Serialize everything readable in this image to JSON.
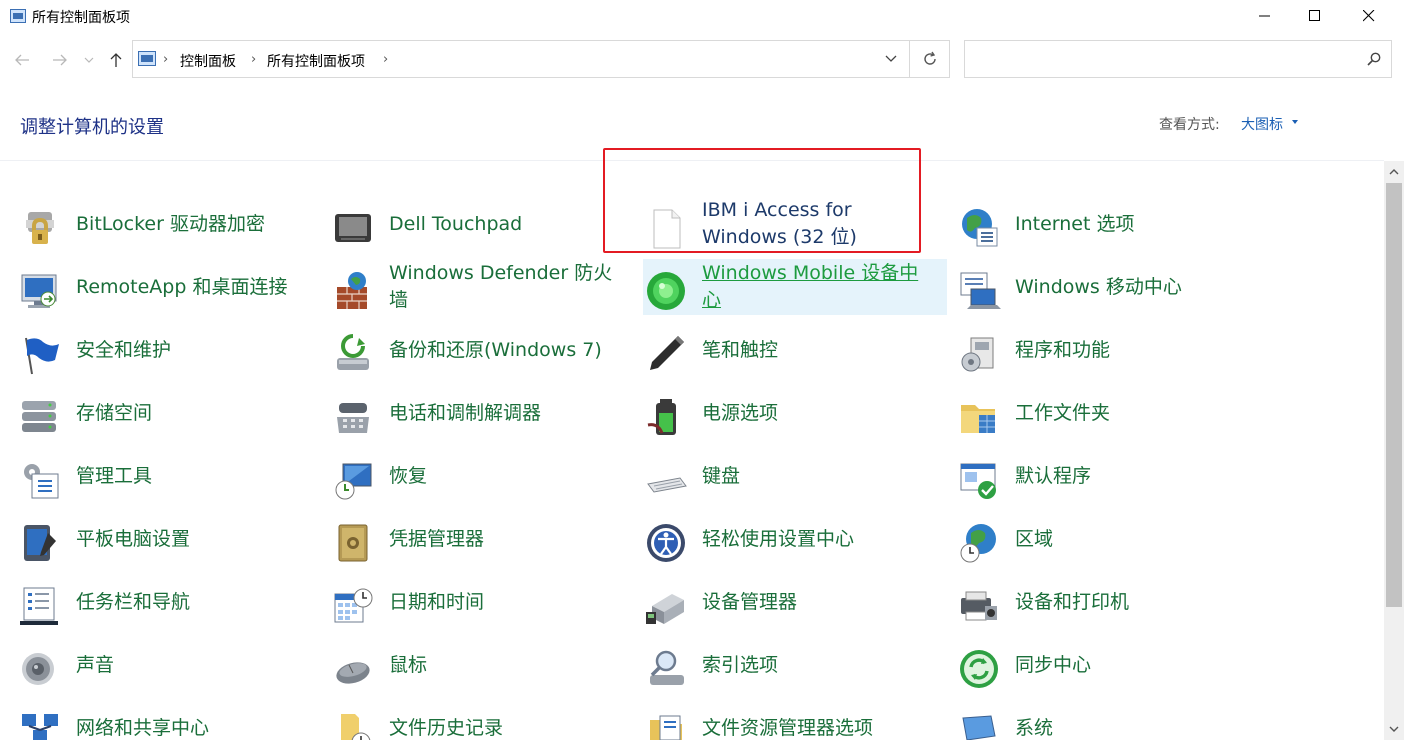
{
  "window": {
    "title": "所有控制面板项"
  },
  "breadcrumb": {
    "items": [
      "控制面板",
      "所有控制面板项"
    ]
  },
  "search": {
    "placeholder": "",
    "value": ""
  },
  "header": {
    "title": "调整计算机的设置",
    "view_by_label": "查看方式:",
    "view_by_value": "大图标"
  },
  "items": [
    {
      "label": "BitLocker 驱动器加密",
      "icon": "bitlocker-icon"
    },
    {
      "label": "Dell Touchpad",
      "icon": "touchpad-icon"
    },
    {
      "label": "IBM i Access for Windows (32 位)",
      "icon": "blank-document-icon"
    },
    {
      "label": "Internet 选项",
      "icon": "internet-options-icon"
    },
    {
      "label": "RemoteApp 和桌面连接",
      "icon": "remoteapp-icon"
    },
    {
      "label": "Windows Defender 防火墙",
      "icon": "firewall-icon"
    },
    {
      "label": "Windows Mobile 设备中心",
      "icon": "mobile-device-center-icon"
    },
    {
      "label": "Windows 移动中心",
      "icon": "mobility-center-icon"
    },
    {
      "label": "安全和维护",
      "icon": "security-flag-icon"
    },
    {
      "label": "备份和还原(Windows 7)",
      "icon": "backup-restore-icon"
    },
    {
      "label": "笔和触控",
      "icon": "pen-icon"
    },
    {
      "label": "程序和功能",
      "icon": "programs-features-icon"
    },
    {
      "label": "存储空间",
      "icon": "storage-spaces-icon"
    },
    {
      "label": "电话和调制解调器",
      "icon": "phone-modem-icon"
    },
    {
      "label": "电源选项",
      "icon": "power-options-icon"
    },
    {
      "label": "工作文件夹",
      "icon": "work-folders-icon"
    },
    {
      "label": "管理工具",
      "icon": "admin-tools-icon"
    },
    {
      "label": "恢复",
      "icon": "recovery-icon"
    },
    {
      "label": "键盘",
      "icon": "keyboard-icon"
    },
    {
      "label": "默认程序",
      "icon": "default-programs-icon"
    },
    {
      "label": "平板电脑设置",
      "icon": "tablet-settings-icon"
    },
    {
      "label": "凭据管理器",
      "icon": "credential-manager-icon"
    },
    {
      "label": "轻松使用设置中心",
      "icon": "ease-of-access-icon"
    },
    {
      "label": "区域",
      "icon": "region-icon"
    },
    {
      "label": "任务栏和导航",
      "icon": "taskbar-icon"
    },
    {
      "label": "日期和时间",
      "icon": "date-time-icon"
    },
    {
      "label": "设备管理器",
      "icon": "device-manager-icon"
    },
    {
      "label": "设备和打印机",
      "icon": "devices-printers-icon"
    },
    {
      "label": "声音",
      "icon": "sound-icon"
    },
    {
      "label": "鼠标",
      "icon": "mouse-icon"
    },
    {
      "label": "索引选项",
      "icon": "indexing-options-icon"
    },
    {
      "label": "同步中心",
      "icon": "sync-center-icon"
    },
    {
      "label": "网络和共享中心",
      "icon": "network-sharing-icon"
    },
    {
      "label": "文件历史记录",
      "icon": "file-history-icon"
    },
    {
      "label": "文件资源管理器选项",
      "icon": "explorer-options-icon"
    },
    {
      "label": "系统",
      "icon": "system-icon"
    }
  ],
  "colors": {
    "link_green": "#1a6e3a",
    "title_blue": "#1e3287",
    "highlight_red": "#e31b23",
    "hover_bg": "#e5f3fb"
  }
}
